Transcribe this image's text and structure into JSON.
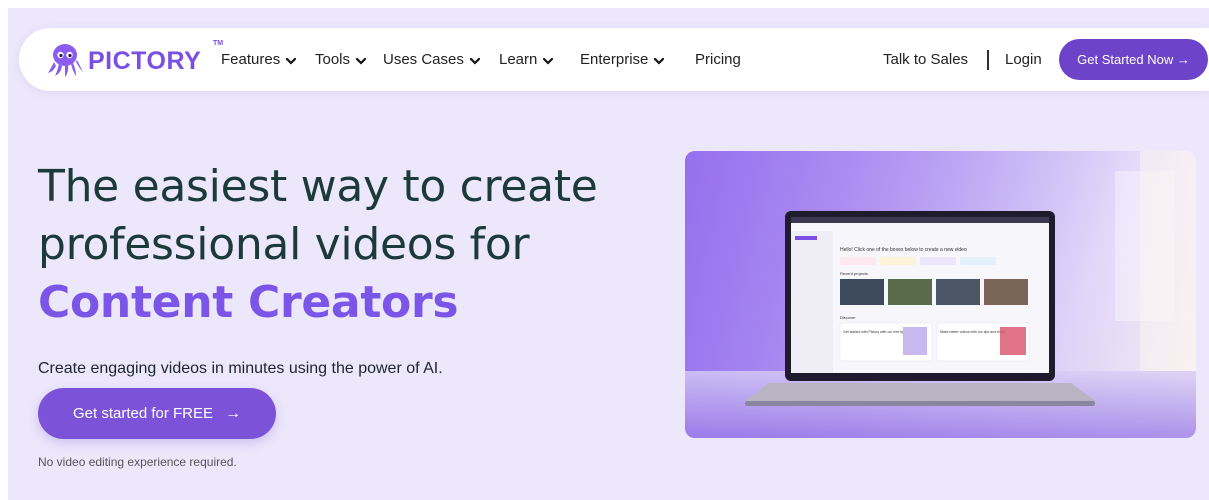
{
  "brand": {
    "name": "PICTORY",
    "tm": "TM",
    "color": "#7b4ee4"
  },
  "nav": {
    "items": [
      {
        "label": "Features",
        "has_menu": true
      },
      {
        "label": "Tools",
        "has_menu": true
      },
      {
        "label": "Uses Cases",
        "has_menu": true
      },
      {
        "label": "Learn",
        "has_menu": true
      },
      {
        "label": "Enterprise",
        "has_menu": true
      },
      {
        "label": "Pricing",
        "has_menu": false
      }
    ],
    "talk_to_sales": "Talk to Sales",
    "login": "Login",
    "cta": "Get Started Now →",
    "cta_color": "#6d43c9"
  },
  "hero": {
    "title_line1": "The easiest way to create",
    "title_line2": "professional videos for",
    "title_line3": "Content Creators",
    "subtitle": "Create engaging videos in minutes using the power of AI.",
    "button": "Get started for FREE",
    "button_icon": "arrow-right-icon",
    "note": "No video editing experience required."
  },
  "screen": {
    "greeting": "Hello! Click one of the boxes below to create a new video",
    "recent_projects": "Recent projects",
    "discover": "Discover",
    "card1": "Get started with Pictory with our free tips",
    "card2": "Make better videos with our tips and tricks"
  }
}
